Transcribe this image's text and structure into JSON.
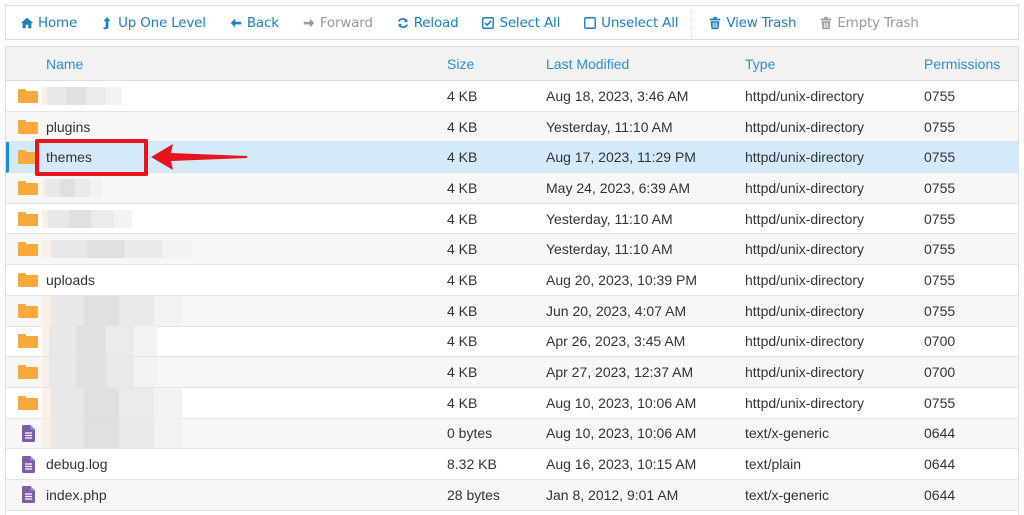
{
  "toolbar": {
    "buttons": [
      {
        "label": "Home",
        "icon": "home-icon",
        "enabled": true
      },
      {
        "label": "Up One Level",
        "icon": "level-up-icon",
        "enabled": true
      },
      {
        "label": "Back",
        "icon": "arrow-left-icon",
        "enabled": true
      },
      {
        "label": "Forward",
        "icon": "arrow-right-icon",
        "enabled": false
      },
      {
        "label": "Reload",
        "icon": "reload-icon",
        "enabled": true
      },
      {
        "label": "Select All",
        "icon": "checkbox-checked-icon",
        "enabled": true
      },
      {
        "label": "Unselect All",
        "icon": "checkbox-empty-icon",
        "enabled": true
      },
      {
        "label": "View Trash",
        "icon": "trash-icon",
        "enabled": true
      },
      {
        "label": "Empty Trash",
        "icon": "trash-icon",
        "enabled": false
      }
    ]
  },
  "colors": {
    "accent": "#1a7fbf",
    "header_text": "#2a8ed0",
    "folder": "#f8a93c",
    "file": "#7b5ea7",
    "selected_row": "#d3ebf8",
    "annotation": "#e8141c"
  },
  "table": {
    "columns": [
      "Name",
      "Size",
      "Last Modified",
      "Type",
      "Permissions"
    ],
    "rows": [
      {
        "icon": "folder",
        "name": "",
        "redacted": true,
        "size": "4 KB",
        "modified": "Aug 18, 2023, 3:46 AM",
        "type": "httpd/unix-directory",
        "perms": "0755"
      },
      {
        "icon": "folder",
        "name": "plugins",
        "redacted": false,
        "size": "4 KB",
        "modified": "Yesterday, 11:10 AM",
        "type": "httpd/unix-directory",
        "perms": "0755"
      },
      {
        "icon": "folder",
        "name": "themes",
        "redacted": false,
        "selected": true,
        "size": "4 KB",
        "modified": "Aug 17, 2023, 11:29 PM",
        "type": "httpd/unix-directory",
        "perms": "0755"
      },
      {
        "icon": "folder",
        "name": "",
        "redacted": true,
        "size": "4 KB",
        "modified": "May 24, 2023, 6:39 AM",
        "type": "httpd/unix-directory",
        "perms": "0755"
      },
      {
        "icon": "folder",
        "name": "",
        "redacted": true,
        "size": "4 KB",
        "modified": "Yesterday, 11:10 AM",
        "type": "httpd/unix-directory",
        "perms": "0755"
      },
      {
        "icon": "folder",
        "name": "",
        "redacted": true,
        "size": "4 KB",
        "modified": "Yesterday, 11:10 AM",
        "type": "httpd/unix-directory",
        "perms": "0755"
      },
      {
        "icon": "folder",
        "name": "uploads",
        "redacted": false,
        "size": "4 KB",
        "modified": "Aug 20, 2023, 10:39 PM",
        "type": "httpd/unix-directory",
        "perms": "0755"
      },
      {
        "icon": "folder",
        "name": "",
        "redacted": true,
        "size": "4 KB",
        "modified": "Jun 20, 2023, 4:07 AM",
        "type": "httpd/unix-directory",
        "perms": "0755"
      },
      {
        "icon": "folder",
        "name": "",
        "redacted": true,
        "size": "4 KB",
        "modified": "Apr 26, 2023, 3:45 AM",
        "type": "httpd/unix-directory",
        "perms": "0700"
      },
      {
        "icon": "folder",
        "name": "",
        "redacted": true,
        "size": "4 KB",
        "modified": "Apr 27, 2023, 12:37 AM",
        "type": "httpd/unix-directory",
        "perms": "0700"
      },
      {
        "icon": "folder",
        "name": "",
        "redacted": true,
        "size": "4 KB",
        "modified": "Aug 10, 2023, 10:06 AM",
        "type": "httpd/unix-directory",
        "perms": "0755"
      },
      {
        "icon": "file",
        "name": "",
        "redacted": true,
        "size": "0 bytes",
        "modified": "Aug 10, 2023, 10:06 AM",
        "type": "text/x-generic",
        "perms": "0644"
      },
      {
        "icon": "file",
        "name": "debug.log",
        "redacted": false,
        "size": "8.32 KB",
        "modified": "Aug 16, 2023, 10:15 AM",
        "type": "text/plain",
        "perms": "0644"
      },
      {
        "icon": "file",
        "name": "index.php",
        "redacted": false,
        "size": "28 bytes",
        "modified": "Jan 8, 2012, 9:01 AM",
        "type": "text/x-generic",
        "perms": "0644"
      }
    ]
  },
  "annotation": {
    "target": "themes",
    "style": "red-box-with-arrow"
  }
}
